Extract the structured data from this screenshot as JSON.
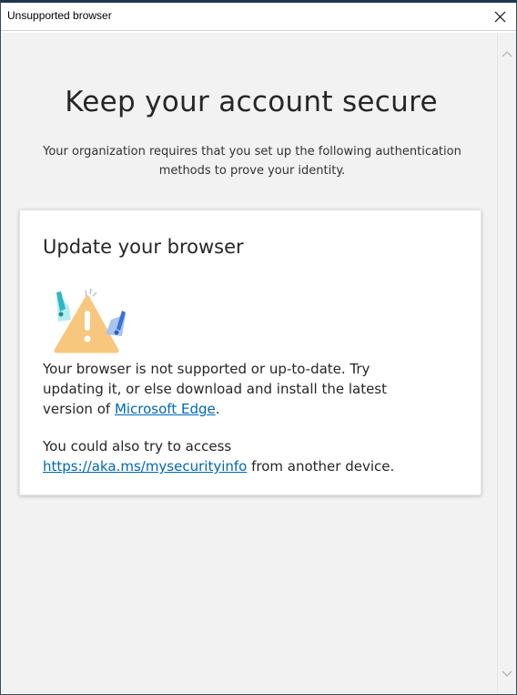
{
  "window": {
    "title": "Unsupported browser"
  },
  "page": {
    "heading": "Keep your account secure",
    "subtitle": "Your organization requires that you set up the following authentication methods to prove your identity."
  },
  "card": {
    "title": "Update your browser",
    "para1_before_link": "Your browser is not supported or up-to-date. Try updating it, or else download and install the latest version of ",
    "para1_link": "Microsoft Edge",
    "para1_after_link": ".",
    "para2_before_link": "You could also try to access ",
    "para2_link": "https://aka.ms/mysecurityinfo",
    "para2_after_link": " from another device."
  },
  "icons": {
    "close": "close-icon",
    "warning": "warning-illustration",
    "scroll_up": "chevron-up-icon",
    "scroll_down": "chevron-down-icon"
  },
  "colors": {
    "link": "#0067b8",
    "background": "#f2f2f2",
    "card": "#ffffff",
    "warning": "#f8c77e"
  }
}
